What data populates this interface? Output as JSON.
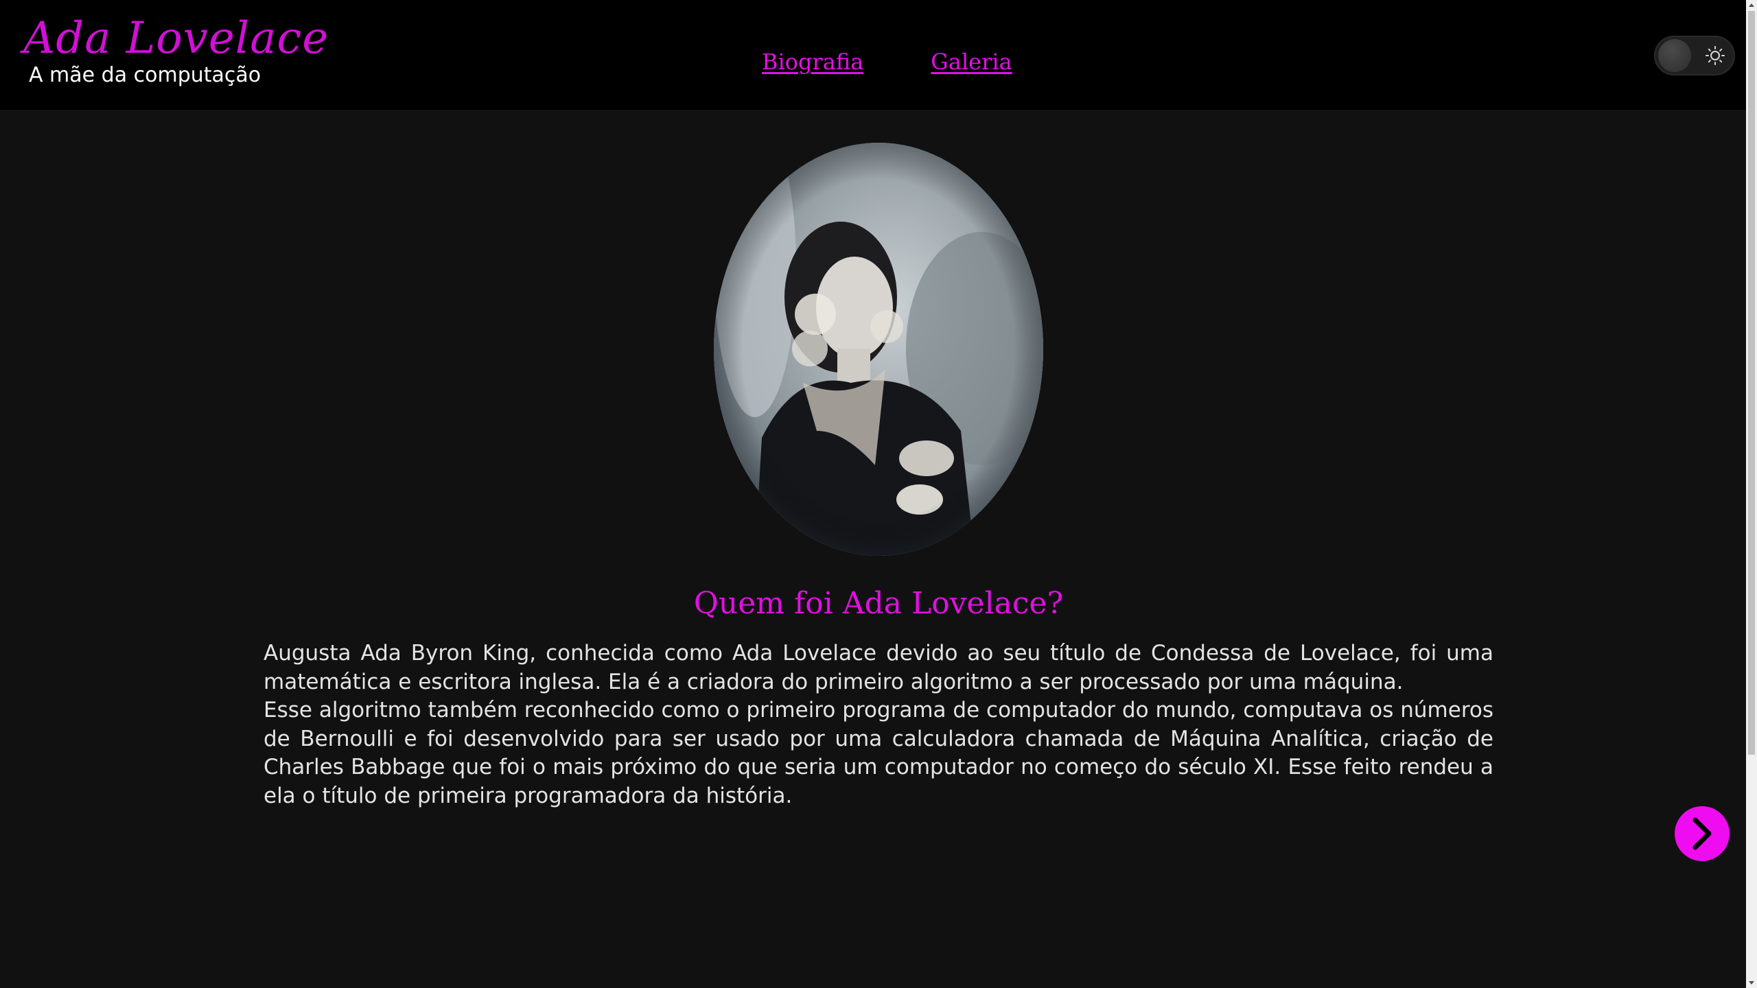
{
  "header": {
    "brand_name": "Ada Lovelace",
    "tagline": "A mãe da computação",
    "nav": [
      {
        "label": "Biografia"
      },
      {
        "label": "Galeria"
      }
    ],
    "theme_toggle": {
      "icon": "sun-icon",
      "state": "dark"
    }
  },
  "portrait": {
    "subject": "Ada Lovelace",
    "shape": "oval"
  },
  "main": {
    "heading": "Quem foi Ada Lovelace?",
    "paragraphs": [
      "Augusta Ada Byron King, conhecida como Ada Lovelace devido ao seu título de Condessa de Lovelace, foi uma matemática e escritora inglesa. Ela é a criadora do primeiro algoritmo a ser processado por uma máquina.",
      "Esse algoritmo também reconhecido como o primeiro programa de computador do mundo, computava os números de Bernoulli e foi desenvolvido para ser usado por uma calculadora chamada de Máquina Analítica, criação de Charles Babbage que foi o mais próximo do que seria um computador no começo do século XI. Esse feito rendeu a ela o título de primeira programadora da história."
    ],
    "next_button": {
      "icon": "chevron-right-icon"
    }
  },
  "colors": {
    "accent": "#e010e0",
    "header_bg": "#000000",
    "page_bg": "#111112",
    "text": "#e4e4e4"
  }
}
